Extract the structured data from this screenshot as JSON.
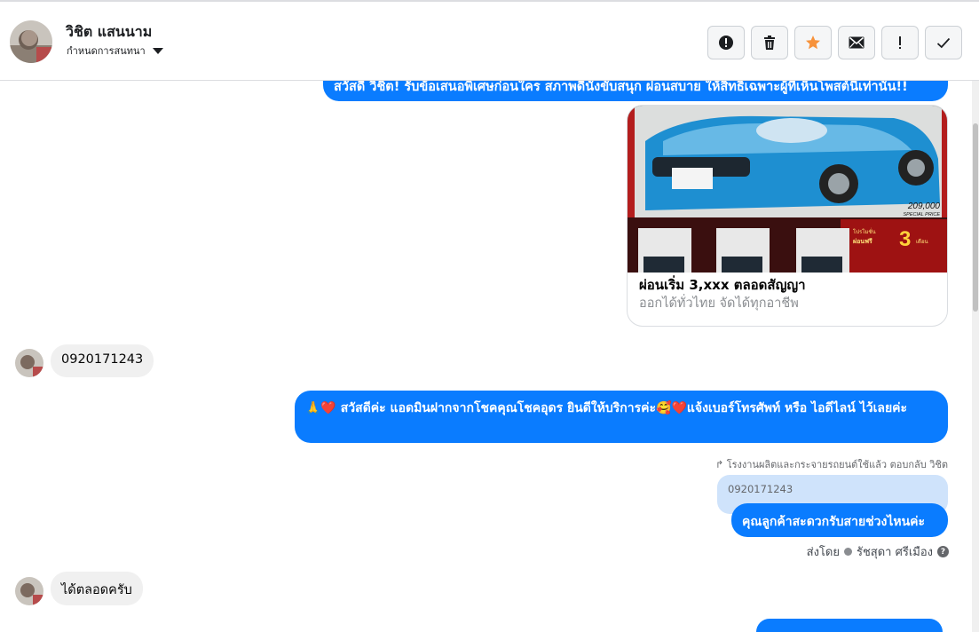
{
  "header": {
    "contact_name": "วิชิต แสนนาม",
    "assign_label": "กำหนดการสนทนา",
    "actions": [
      {
        "name": "mark-spam-button",
        "icon": "alert-circle-icon"
      },
      {
        "name": "delete-button",
        "icon": "trash-icon"
      },
      {
        "name": "star-button",
        "icon": "star-icon"
      },
      {
        "name": "mark-unread-button",
        "icon": "envelope-icon"
      },
      {
        "name": "follow-up-button",
        "icon": "exclamation-icon"
      },
      {
        "name": "mark-done-button",
        "icon": "checkmark-icon"
      }
    ]
  },
  "messages": {
    "top_outgoing": "สวัสดี วิชิต! รับข้อเสนอพิเศษก่อนใคร สภาพดีนั่งขับสนุก ผ่อนสบาย ให้สิทธิเฉพาะผู้ที่เห็นโพสต์นี้เท่านั้น!!",
    "card": {
      "title": "ผ่อนเริ่ม 3,xxx ตลอดสัญญา",
      "subtitle": "ออกได้ทั่วไทย จัดได้ทุกอาชีพ",
      "image_price": "209,000",
      "image_price_caption": "SPECIAL PRICE",
      "image_promo_line1": "โปรโมชั่น",
      "image_promo_line2": "ผ่อนฟรี",
      "image_promo_number": "3",
      "image_promo_unit": "เดือน"
    },
    "incoming_phone": "0920171243",
    "outgoing_greeting": "🙏❤️ สวัสดีค่ะ แอดมินฝากจากโชคคุณโชคอุดร ยินดีให้บริการค่ะ🥰❤️แจ้งเบอร์โทรศัพท์ หรือ ไอดีไลน์  ไว้เลยค่ะ",
    "reply_meta": "โรงงานผลิตและกระจายรถยนต์ใช้แล้ว ตอบกลับ วิชิต",
    "quoted_text": "0920171243",
    "outgoing_question": "คุณลูกค้าสะดวกรับสายช่วงไหนค่ะ",
    "sent_by_label": "ส่งโดย",
    "sent_by_name": "รัชสุดา ศรีเมือง",
    "incoming_reply": "ได้ตลอดครับ"
  },
  "colors": {
    "outgoing_bubble": "#0a7cff",
    "incoming_bubble": "#f0f0f0",
    "star_accent": "#f7923b"
  }
}
